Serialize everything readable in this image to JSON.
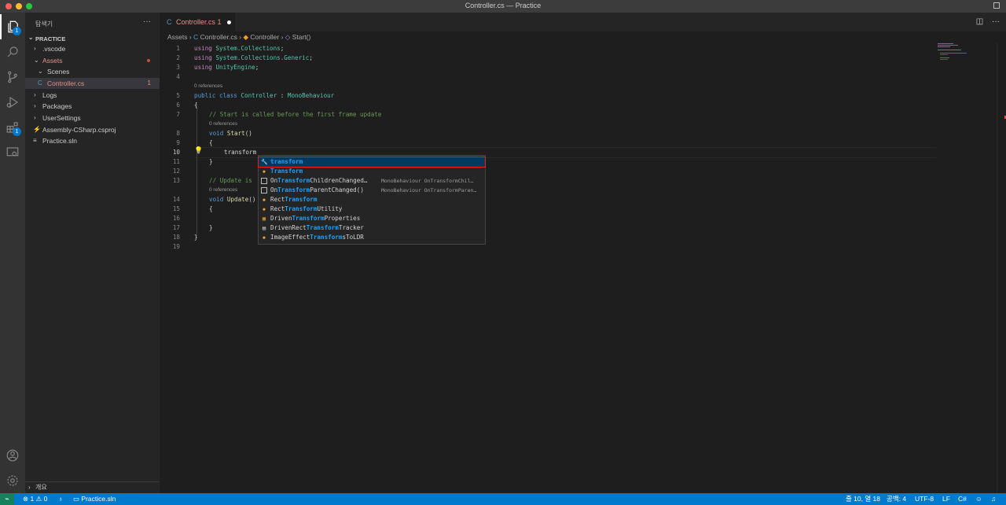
{
  "window": {
    "title": "Controller.cs — Practice"
  },
  "activity_bar": {
    "explorer_badge": "1",
    "extensions_badge": "1"
  },
  "explorer": {
    "header": "탐색기",
    "more": "···",
    "section": "PRACTICE",
    "items": [
      {
        "label": ".vscode",
        "chevron": "›"
      },
      {
        "label": "Assets",
        "chevron": "⌄"
      },
      {
        "label": "Scenes",
        "chevron": "⌄"
      },
      {
        "label": "Controller.cs",
        "icon": "C",
        "count": "1"
      },
      {
        "label": "Logs",
        "chevron": "›"
      },
      {
        "label": "Packages",
        "chevron": "›"
      },
      {
        "label": "UserSettings",
        "chevron": "›"
      },
      {
        "label": "Assembly-CSharp.csproj",
        "icon": "⚡"
      },
      {
        "label": "Practice.sln",
        "icon": "≡"
      }
    ],
    "outline": "개요"
  },
  "tab": {
    "icon": "C",
    "label": "Controller.cs",
    "count": "1"
  },
  "breadcrumb": {
    "items": [
      "Assets",
      "Controller.cs",
      "Controller",
      "Start()"
    ]
  },
  "editor": {
    "line_numbers": [
      "1",
      "2",
      "3",
      "4",
      "5",
      "6",
      "7",
      "8",
      "9",
      "10",
      "11",
      "12",
      "13",
      "14",
      "15",
      "16",
      "17",
      "18",
      "19"
    ],
    "code_lens": "0 references",
    "lines": {
      "l1": [
        "using",
        "System.Collections",
        ";"
      ],
      "l2": [
        "using",
        "System.Collections.Generic",
        ";"
      ],
      "l3": [
        "using",
        "UnityEngine",
        ";"
      ],
      "l5": [
        "public",
        "class",
        "Controller",
        " : ",
        "MonoBehaviour"
      ],
      "l6": "{",
      "l7": "// Start is called before the first frame update",
      "l8": [
        "void",
        "Start",
        "()"
      ],
      "l9": "{",
      "l10": "transform",
      "l11": "}",
      "l13": "// Update is",
      "l14": [
        "void",
        "Update",
        "()"
      ],
      "l15": "{",
      "l17": "}",
      "l18": "}"
    }
  },
  "suggestions": [
    {
      "pre": "",
      "match": "transform",
      "post": "",
      "detail": "",
      "icon": "🔧"
    },
    {
      "pre": "",
      "match": "Transform",
      "post": "",
      "detail": "",
      "icon": "◆"
    },
    {
      "pre": "On",
      "match": "Transform",
      "post": "ChildrenChanged…",
      "detail": "MonoBehaviour OnTransformChil…",
      "icon": ""
    },
    {
      "pre": "On",
      "match": "Transform",
      "post": "ParentChanged()",
      "detail": "MonoBehaviour OnTransformParen…",
      "icon": ""
    },
    {
      "pre": "Rect",
      "match": "Transform",
      "post": "",
      "detail": "",
      "icon": "◆"
    },
    {
      "pre": "Rect",
      "match": "Transform",
      "post": "Utility",
      "detail": "",
      "icon": "◆"
    },
    {
      "pre": "Driven",
      "match": "Transform",
      "post": "Properties",
      "detail": "",
      "icon": "▦"
    },
    {
      "pre": "DrivenRect",
      "match": "Transform",
      "post": "Tracker",
      "detail": "",
      "icon": "▤"
    },
    {
      "pre": "ImageEffect",
      "match": "Transform",
      "post": "sToLDR",
      "detail": "",
      "icon": "◆"
    }
  ],
  "status": {
    "remote": "⌁",
    "errors": "⊗ 1",
    "warnings": "⚠ 0",
    "sync": "♁",
    "solution": "Practice.sln",
    "position": "줄 10, 열 18",
    "spaces": "공백: 4",
    "encoding": "UTF-8",
    "eol": "LF",
    "language": "C#"
  },
  "colors": {
    "accent": "#007acc",
    "selection_outline": "#ff1a1a",
    "match": "#18a3ff"
  }
}
